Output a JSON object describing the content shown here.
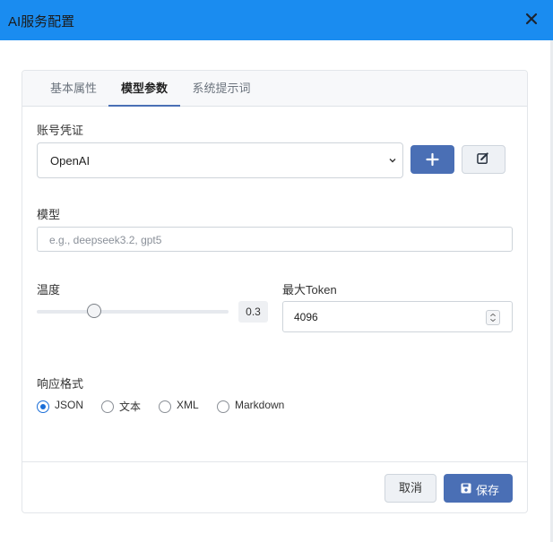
{
  "dialog": {
    "title": "AI服务配置"
  },
  "tabs": [
    {
      "label": "基本属性",
      "active": false
    },
    {
      "label": "模型参数",
      "active": true
    },
    {
      "label": "系统提示词",
      "active": false
    }
  ],
  "account": {
    "label": "账号凭证",
    "selected": "OpenAI"
  },
  "model": {
    "label": "模型",
    "placeholder": "e.g., deepseek3.2, gpt5",
    "value": ""
  },
  "temperature": {
    "label": "温度",
    "value": "0.3",
    "fraction": 0.3
  },
  "max_token": {
    "label": "最大Token",
    "value": "4096"
  },
  "response_format": {
    "label": "响应格式",
    "options": [
      "JSON",
      "文本",
      "XML",
      "Markdown"
    ],
    "selected": "JSON"
  },
  "footer": {
    "cancel_label": "取消",
    "save_label": "保存"
  },
  "colors": {
    "titlebar": "#1a8cf0",
    "primary_button": "#4a6fb5",
    "radio_checked": "#1a6ed8"
  },
  "icons": {
    "close": "close-icon",
    "dropdown": "chevron-down-icon",
    "add": "plus-icon",
    "edit": "edit-icon",
    "save": "save-icon",
    "spinner": "spinner-icon"
  }
}
